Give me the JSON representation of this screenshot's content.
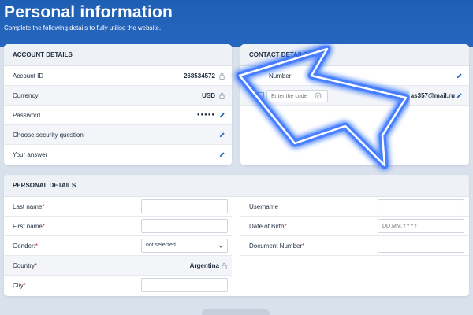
{
  "header": {
    "title": "Personal information",
    "subtitle": "Complete the following details to fully utilise the website."
  },
  "account": {
    "title": "ACCOUNT DETAILS",
    "rows": [
      {
        "label": "Account ID",
        "value": "268534572"
      },
      {
        "label": "Currency",
        "value": "USD"
      },
      {
        "label": "Password",
        "value": "●●●●●"
      },
      {
        "label": "Choose security question",
        "value": ""
      },
      {
        "label": "Your answer",
        "value": ""
      }
    ]
  },
  "contact": {
    "title": "CONTACT DETAILS",
    "phone_label": "Number",
    "code_placeholder": "Enter the code",
    "email": "as357@mail.ru"
  },
  "personal": {
    "title": "PERSONAL DETAILS",
    "last_name": "Last name",
    "first_name": "First name",
    "gender": "Gender:",
    "gender_value": "not selected",
    "country": "Country",
    "country_value": "Argentina",
    "city": "City",
    "username": "Username",
    "dob": "Date of Birth",
    "dob_placeholder": "DD.MM.YYYY",
    "document": "Document Number",
    "required_mark": "*"
  },
  "colors": {
    "brand_blue": "#2666bf",
    "accent_blue": "#1f5fb3",
    "required_red": "#d12b2b",
    "neon_arrow": "#2a6bff"
  },
  "icons": {
    "lock": "lock-icon",
    "pencil": "pencil-icon",
    "chevron": "chevron-down-icon",
    "confirm": "check-circle-icon"
  }
}
